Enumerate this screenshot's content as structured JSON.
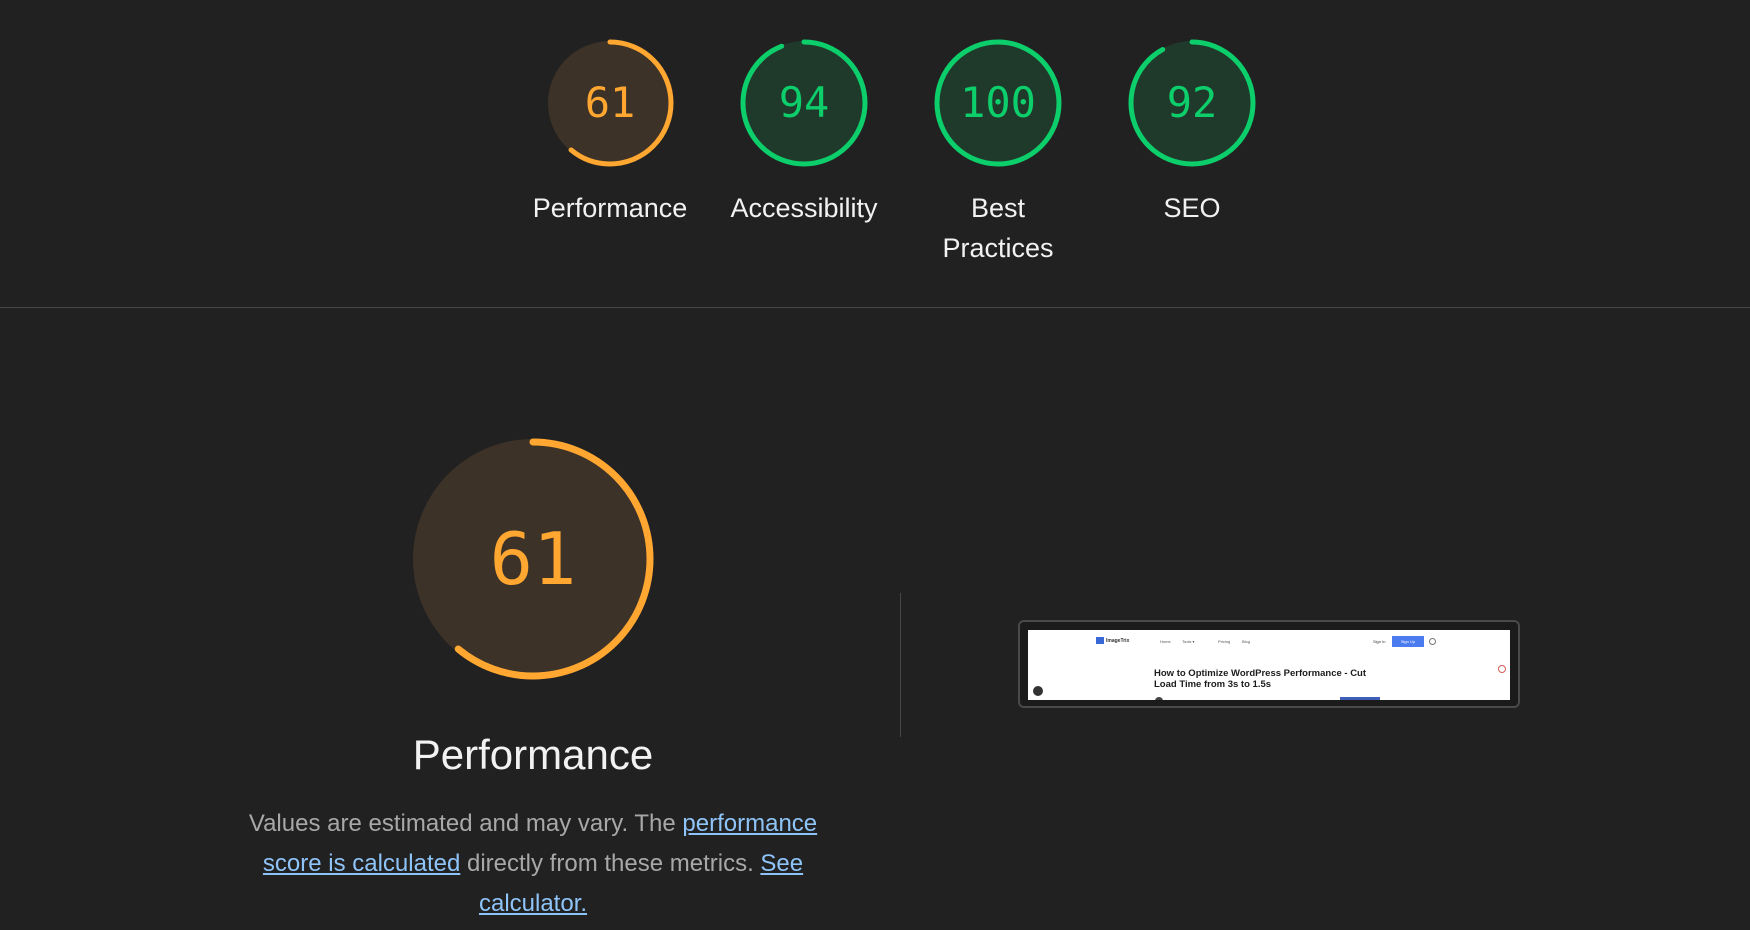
{
  "colors": {
    "background": "#212121",
    "average": "#ffa731",
    "average_fill": "#3d3227",
    "pass": "#0cce6b",
    "pass_fill": "#1f3a2a",
    "link": "#8ec4f8",
    "text": "#f2f2f2",
    "muted_text": "#a8a8a8"
  },
  "gauges": [
    {
      "name": "performance",
      "score": "61",
      "label": "Performance",
      "value": 61
    },
    {
      "name": "accessibility",
      "score": "94",
      "label": "Accessibility",
      "value": 94
    },
    {
      "name": "best-practices",
      "score": "100",
      "label_line1": "Best",
      "label_line2": "Practices",
      "value": 100
    },
    {
      "name": "seo",
      "score": "92",
      "label": "SEO",
      "value": 92
    }
  ],
  "performance_section": {
    "score": "61",
    "value": 61,
    "title": "Performance",
    "description_prefix": "Values are estimated and may vary. The ",
    "link_score": "performance score is calculated",
    "description_middle": " directly from these metrics. ",
    "link_calculator": "See calculator."
  },
  "screenshot": {
    "brand": "ImageTrix",
    "nav": [
      "Home",
      "Tools ▾",
      "Pricing",
      "Blog"
    ],
    "signin": "Sign In",
    "signup": "Sign Up",
    "headline": "How to Optimize WordPress Performance - Cut Load Time from 3s to 1.5s"
  }
}
